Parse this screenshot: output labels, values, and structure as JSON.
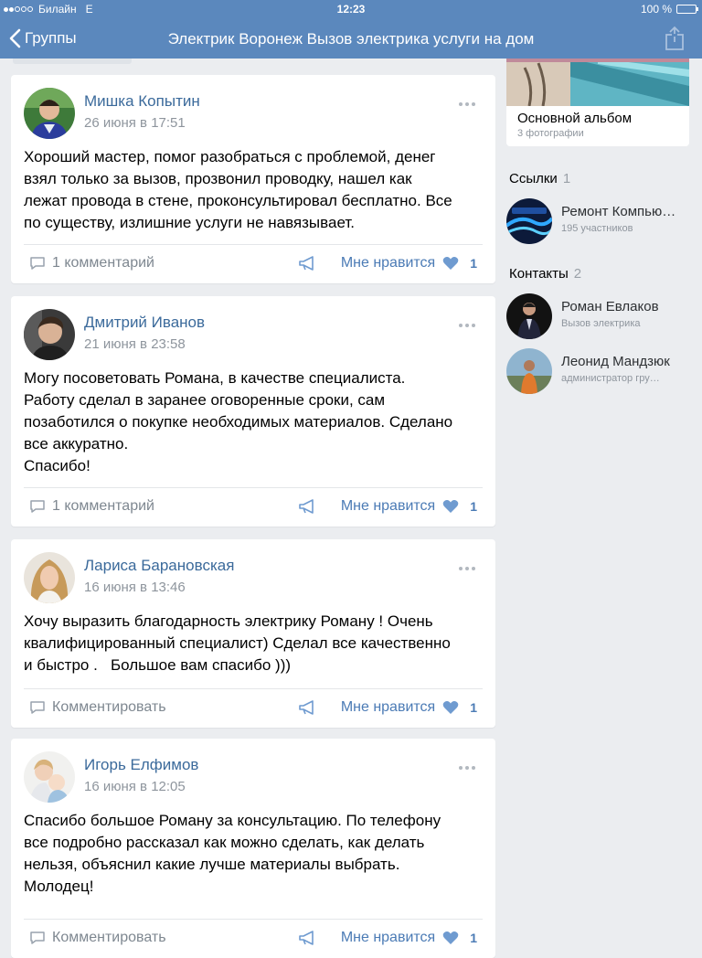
{
  "status_bar": {
    "carrier": "Билайн",
    "network": "E",
    "time": "12:23",
    "battery": "100 %"
  },
  "nav": {
    "back_label": "Группы",
    "title": "Электрик Воронеж Вызов электрика услуги на дом"
  },
  "posts": [
    {
      "author": "Мишка Копытин",
      "date": "26 июня в 17:51",
      "text": "Хороший мастер, помог разобраться с проблемой, денег\nвзял только за вызов, прозвонил проводку, нашел как\nлежат провода в стене, проконсультировал бесплатно. Все\nпо существу, излишние услуги не навязывает.",
      "comment_label": "1 комментарий",
      "like_label": "Мне нравится",
      "like_count": "1"
    },
    {
      "author": "Дмитрий Иванов",
      "date": "21 июня в 23:58",
      "text": "Могу посоветовать Романа, в качестве специалиста.\nРаботу сделал в заранее оговоренные сроки, сам\nпозаботился о покупке необходимых материалов. Сделано\nвсе аккуратно.\nСпасибо!",
      "comment_label": "1 комментарий",
      "like_label": "Мне нравится",
      "like_count": "1"
    },
    {
      "author": "Лариса Барановская",
      "date": "16 июня в 13:46",
      "text": "Хочу выразить благодарность электрику Роману ! Очень\nквалифицированный специалист) Сделал все качественно\nи быстро .   Большое вам спасибо )))",
      "comment_label": "Комментировать",
      "like_label": "Мне нравится",
      "like_count": "1"
    },
    {
      "author": "Игорь Елфимов",
      "date": "16 июня в 12:05",
      "text": "Спасибо большое Роману за консультацию. По телефону\nвсе подробно рассказал как можно сделать, как делать\nнельзя, объяснил какие лучше материалы выбрать.\nМолодец!",
      "comment_label": "Комментировать",
      "like_label": "Мне нравится",
      "like_count": "1"
    }
  ],
  "sidebar": {
    "album": {
      "title": "Основной альбом",
      "subtitle": "3 фотографии"
    },
    "links": {
      "heading": "Ссылки",
      "count": "1",
      "items": [
        {
          "name": "Ремонт Компью…",
          "subtitle": "195 участников"
        }
      ]
    },
    "contacts": {
      "heading": "Контакты",
      "count": "2",
      "items": [
        {
          "name": "Роман Евлаков",
          "subtitle": "Вызов электрика"
        },
        {
          "name": "Леонид Мандзюк",
          "subtitle": "администратор гру…"
        }
      ]
    }
  },
  "colors": {
    "header": "#5b88bd",
    "link": "#3b6a9b",
    "like": "#4b7bb5",
    "background": "#ebedf0"
  }
}
